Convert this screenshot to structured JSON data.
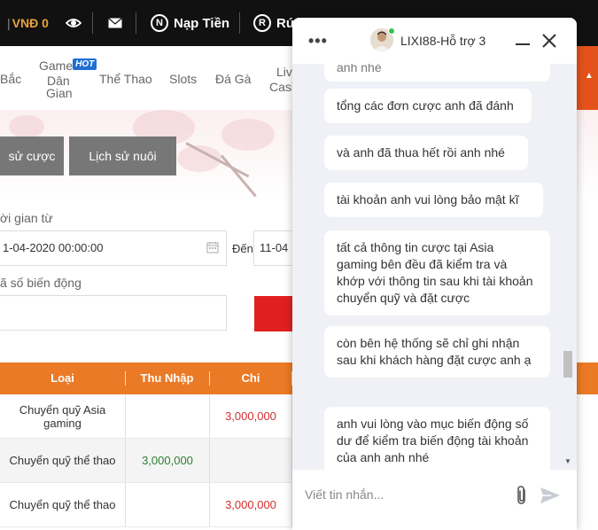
{
  "topbar": {
    "balance": "VNĐ 0",
    "deposit": {
      "icon": "N",
      "label": "Nạp Tiền"
    },
    "withdraw": {
      "icon": "R",
      "label": "Rú"
    }
  },
  "nav": {
    "items": [
      "Bắc",
      "Game",
      "Dân",
      "Gian",
      "Thể Thao",
      "Slots",
      "Đá Gà",
      "Liv",
      "Casi"
    ],
    "hot_badge": "HOT"
  },
  "tabs": {
    "history": "sử cược",
    "raising": "Lịch sử nuôi"
  },
  "filters": {
    "time_label": "ời gian từ",
    "from_value": "1-04-2020 00:00:00",
    "to_label": "Đến",
    "to_value": "11-04",
    "code_label": "ã số biến động",
    "code_value": ""
  },
  "table": {
    "headers": [
      "Loại",
      "Thu Nhập",
      "Chi"
    ],
    "rows": [
      {
        "type": "Chuyển quỹ Asia gaming",
        "income": "",
        "expense": "3,000,000"
      },
      {
        "type": "Chuyển quỹ thể thao",
        "income": "3,000,000",
        "expense": ""
      },
      {
        "type": "Chuyển quỹ thể thao",
        "income": "",
        "expense": "3,000,000"
      }
    ]
  },
  "chat": {
    "title": "LIXI88-Hỗ trợ 3",
    "partial_message": "anh nhé",
    "messages": [
      "tổng các đơn cược anh đã đánh",
      "và anh đã thua hết rồi anh nhé",
      "tài khoản anh vui lòng bảo mật kĩ",
      "tất cả thông tin cược tại Asia gaming bên đều đã kiểm tra và khớp với thông tin sau khi tài khoản chuyển quỹ và đặt cược",
      "còn bên hệ thống sẽ chỉ ghi nhận sau khi khách hàng đặt cược anh ạ",
      "anh vui lòng vào mục biến động số dư để kiểm tra biến động tài khoản của anh anh nhé"
    ],
    "input_placeholder": "Viết tin nhắn..."
  },
  "colors": {
    "accent_orange": "#ea7a26",
    "danger_red": "#e02020",
    "income_green": "#2e7d32",
    "expense_red": "#d32f2f",
    "topbar": "#111111"
  }
}
